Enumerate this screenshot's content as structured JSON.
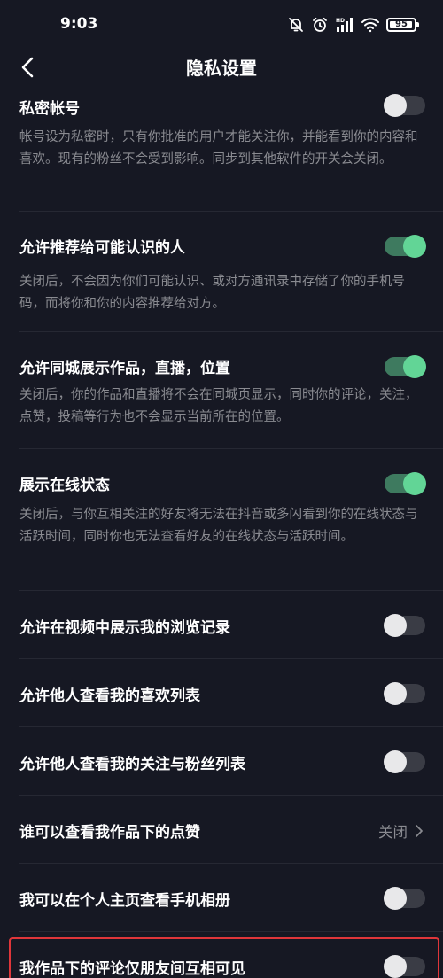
{
  "status_bar": {
    "time": "9:03",
    "battery": "95",
    "battery_level": 0.95
  },
  "header": {
    "title": "隐私设置"
  },
  "settings": {
    "private_account": {
      "title": "私密帐号",
      "desc": "帐号设为私密时，只有你批准的用户才能关注你，并能看到你的内容和喜欢。现有的粉丝不会受到影响。同步到其他软件的开关会关闭。",
      "enabled": false
    },
    "recommend_to_known": {
      "title": "允许推荐给可能认识的人",
      "desc": "关闭后，不会因为你们可能认识、或对方通讯录中存储了你的手机号码，而将你和你的内容推荐给对方。",
      "enabled": true
    },
    "same_city": {
      "title": "允许同城展示作品，直播，位置",
      "desc": "关闭后，你的作品和直播将不会在同城页显示，同时你的评论，关注，点赞，投稿等行为也不会显示当前所在的位置。",
      "enabled": true
    },
    "online_status": {
      "title": "展示在线状态",
      "desc": "关闭后，与你互相关注的好友将无法在抖音或多闪看到你的在线状态与活跃时间，同时你也无法查看好友的在线状态与活跃时间。",
      "enabled": true
    },
    "browse_history": {
      "title": "允许在视频中展示我的浏览记录",
      "enabled": false
    },
    "likes_list": {
      "title": "允许他人查看我的喜欢列表",
      "enabled": false
    },
    "follow_list": {
      "title": "允许他人查看我的关注与粉丝列表",
      "enabled": false
    },
    "who_can_see_likes": {
      "title": "谁可以查看我作品下的点赞",
      "value": "关闭"
    },
    "phone_album": {
      "title": "我可以在个人主页查看手机相册",
      "enabled": false
    },
    "comments_friends_only": {
      "title": "我作品下的评论仅朋友间互相可见",
      "enabled": false
    }
  },
  "colors": {
    "background": "#161823",
    "toggle_on": "#62d596",
    "toggle_off_track": "#3a3c45",
    "highlight": "#e0363a"
  }
}
